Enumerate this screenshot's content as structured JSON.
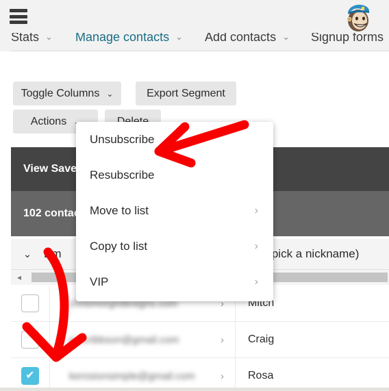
{
  "topbar": {
    "menu_icon": "hamburger-icon",
    "avatar_icon": "mailchimp-freddie-avatar"
  },
  "nav": {
    "items": [
      {
        "label": "Stats",
        "caret": "⌄",
        "active": false
      },
      {
        "label": "Manage contacts",
        "caret": "⌄",
        "active": true
      },
      {
        "label": "Add contacts",
        "caret": "⌄",
        "active": false
      },
      {
        "label": "Signup forms",
        "caret": "",
        "active": false
      }
    ],
    "active_color": "#1a6d86"
  },
  "toolbar": {
    "toggle_columns": "Toggle Columns",
    "toggle_columns_caret": "⌄",
    "export_segment": "Export Segment",
    "actions": "Actions",
    "actions_caret": "⌄",
    "delete": "Delete"
  },
  "bars": {
    "saved_segments": "View Saved",
    "contacts_count": "102 contac"
  },
  "table": {
    "sort_caret": "⌄",
    "col_email": "Em",
    "col_name": "me (or pick a nickname)",
    "scroll_left_arrow": "◂",
    "rows": [
      {
        "checked": false,
        "email": "chrismorgndesigns.com",
        "chevron": "›",
        "name": "Mitch"
      },
      {
        "checked": false,
        "email": "g.scribbson@gmail.com",
        "chevron": "›",
        "name": "Craig"
      },
      {
        "checked": true,
        "email": "kerosionsimple@gmail.com",
        "chevron": "›",
        "name": "Rosa"
      }
    ]
  },
  "dropdown": {
    "items": [
      {
        "label": "Unsubscribe",
        "submenu": false,
        "chevron": ""
      },
      {
        "label": "Resubscribe",
        "submenu": false,
        "chevron": ""
      },
      {
        "label": "Move to list",
        "submenu": true,
        "chevron": "›"
      },
      {
        "label": "Copy to list",
        "submenu": true,
        "chevron": "›"
      },
      {
        "label": "VIP",
        "submenu": true,
        "chevron": "›"
      }
    ]
  },
  "annotations": {
    "color": "#f90000",
    "arrow_to_unsubscribe": "arrow pointing left at Unsubscribe",
    "arrow_to_checkbox": "arrow pointing down at selected row checkbox"
  }
}
